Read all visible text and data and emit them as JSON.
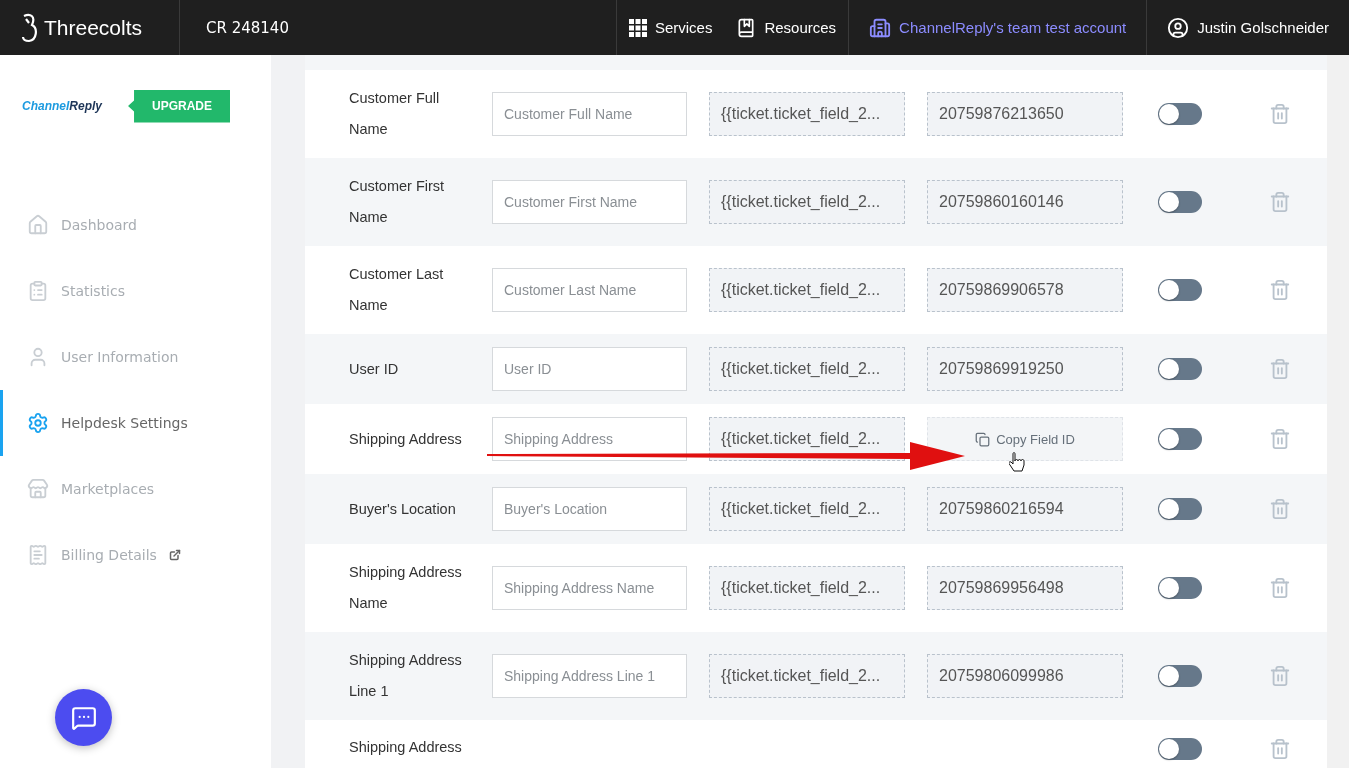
{
  "header": {
    "brand": "Threecolts",
    "account_code": "CR 248140",
    "nav": [
      {
        "kind": "services",
        "label": "Services"
      },
      {
        "kind": "resources",
        "label": "Resources"
      },
      {
        "kind": "team",
        "label": "ChannelReply's team test account"
      },
      {
        "kind": "user",
        "label": "Justin Golschneider"
      }
    ]
  },
  "sidebar": {
    "logo": {
      "first": "Channel",
      "second": "Reply"
    },
    "upgrade": "UPGRADE",
    "items": [
      {
        "kind": "home",
        "label": "Dashboard",
        "selected": false,
        "external": false
      },
      {
        "kind": "stats",
        "label": "Statistics",
        "selected": false,
        "external": false
      },
      {
        "kind": "user",
        "label": "User Information",
        "selected": false,
        "external": false
      },
      {
        "kind": "settings",
        "label": "Helpdesk Settings",
        "selected": true,
        "external": false
      },
      {
        "kind": "store",
        "label": "Marketplaces",
        "selected": false,
        "external": false
      },
      {
        "kind": "billing",
        "label": "Billing Details",
        "selected": false,
        "external": true
      }
    ]
  },
  "fields": [
    {
      "label": "Customer Full Name",
      "placeholder": "Customer Full Name",
      "template": "{{ticket.ticket_field_2...",
      "field_id": "20759876213650",
      "on": false,
      "hovered": false
    },
    {
      "label": "Customer First Name",
      "placeholder": "Customer First Name",
      "template": "{{ticket.ticket_field_2...",
      "field_id": "20759860160146",
      "on": false,
      "hovered": false
    },
    {
      "label": "Customer Last Name",
      "placeholder": "Customer Last Name",
      "template": "{{ticket.ticket_field_2...",
      "field_id": "20759869906578",
      "on": false,
      "hovered": false
    },
    {
      "label": "User ID",
      "placeholder": "User ID",
      "template": "{{ticket.ticket_field_2...",
      "field_id": "20759869919250",
      "on": false,
      "hovered": false
    },
    {
      "label": "Shipping Address",
      "placeholder": "Shipping Address",
      "template": "{{ticket.ticket_field_2...",
      "copy_label": "Copy Field ID",
      "on": false,
      "hovered": true
    },
    {
      "label": "Buyer's Location",
      "placeholder": "Buyer's Location",
      "template": "{{ticket.ticket_field_2...",
      "field_id": "20759860216594",
      "on": false,
      "hovered": false
    },
    {
      "label": "Shipping Address Name",
      "placeholder": "Shipping Address Name",
      "template": "{{ticket.ticket_field_2...",
      "field_id": "20759869956498",
      "on": false,
      "hovered": false
    },
    {
      "label": "Shipping Address Line 1",
      "placeholder": "Shipping Address Line 1",
      "template": "{{ticket.ticket_field_2...",
      "field_id": "20759806099986",
      "on": false,
      "hovered": false
    },
    {
      "label": "Shipping Address",
      "on": false,
      "hovered": false
    }
  ]
}
